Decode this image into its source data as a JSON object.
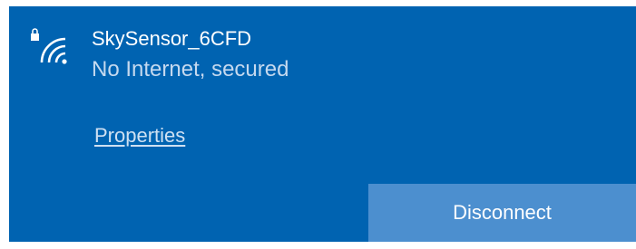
{
  "network": {
    "name": "SkySensor_6CFD",
    "status": "No Internet, secured",
    "icon": "wifi-secured-icon"
  },
  "actions": {
    "properties_label": "Properties",
    "disconnect_label": "Disconnect"
  },
  "colors": {
    "panel_background": "#0063b1",
    "status_text": "#c5d9ef",
    "button_background": "#4c8fcf"
  }
}
